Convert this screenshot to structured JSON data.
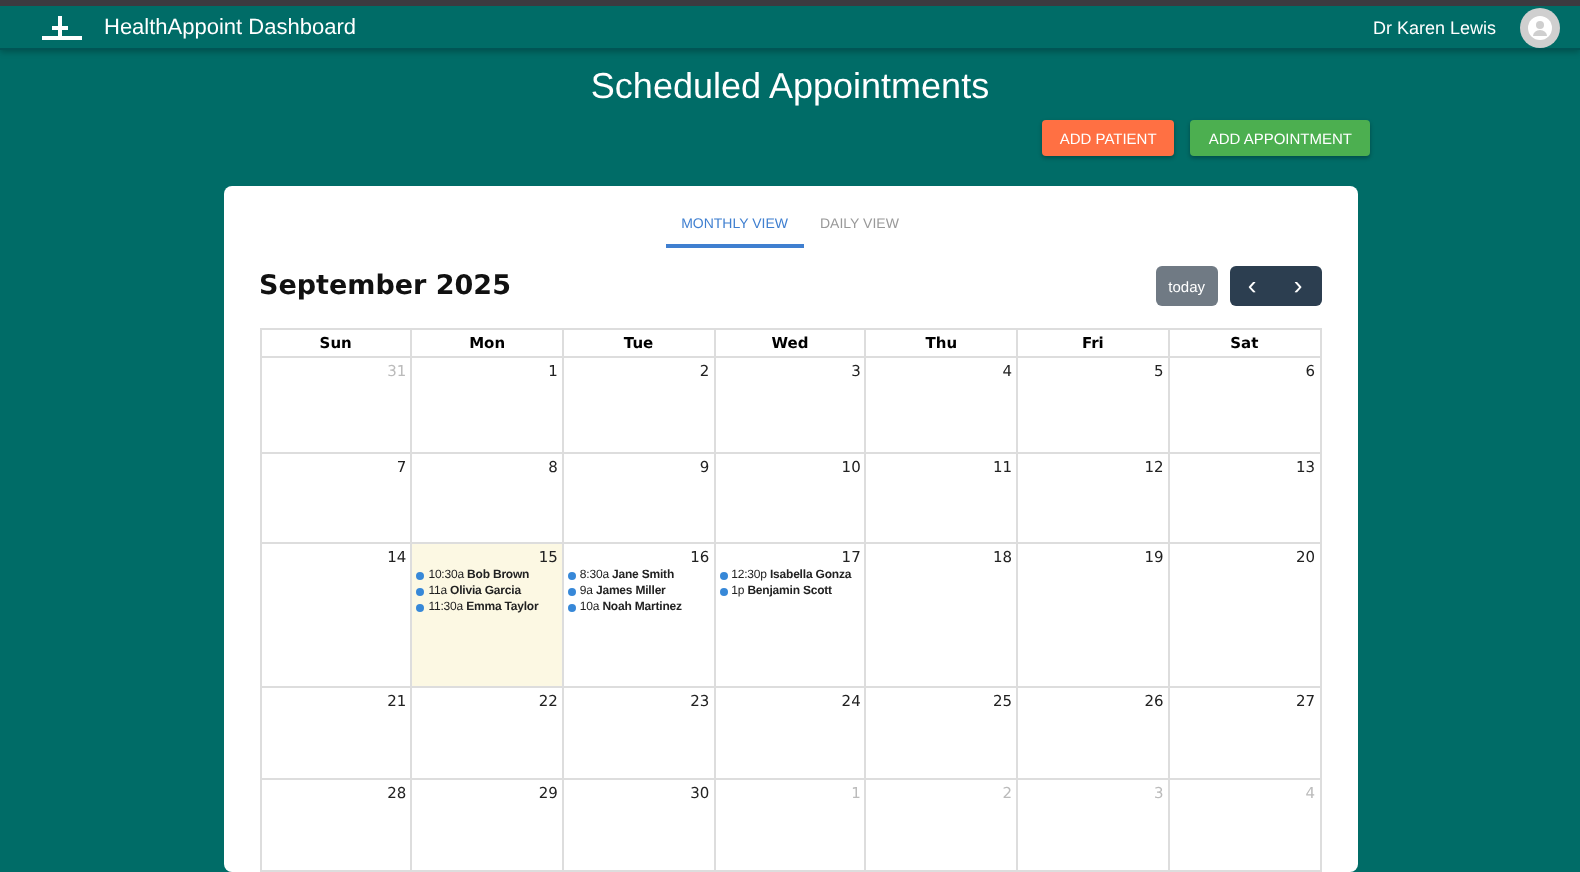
{
  "header": {
    "title": "HealthAppoint Dashboard",
    "user": "Dr Karen Lewis"
  },
  "page_title": "Scheduled Appointments",
  "actions": [
    {
      "label": "ADD PATIENT",
      "kind": "secondary"
    },
    {
      "label": "ADD APPOINTMENT",
      "kind": "primary"
    }
  ],
  "tabs": [
    {
      "label": "MONTHLY VIEW",
      "selected": true
    },
    {
      "label": "DAILY VIEW",
      "selected": false
    }
  ],
  "calendar": {
    "title": "September 2025",
    "today_label": "today",
    "prev": "‹",
    "next": "›",
    "weekdays": [
      "Sun",
      "Mon",
      "Tue",
      "Wed",
      "Thu",
      "Fri",
      "Sat"
    ],
    "weeks": [
      [
        {
          "day": "31",
          "other_month": true,
          "today": false
        },
        {
          "day": "1",
          "other_month": false,
          "today": false
        },
        {
          "day": "2",
          "other_month": false,
          "today": false
        },
        {
          "day": "3",
          "other_month": false,
          "today": false
        },
        {
          "day": "4",
          "other_month": false,
          "today": false
        },
        {
          "day": "5",
          "other_month": false,
          "today": false
        },
        {
          "day": "6",
          "other_month": false,
          "today": false
        }
      ],
      [
        {
          "day": "7",
          "other_month": false,
          "today": false
        },
        {
          "day": "8",
          "other_month": false,
          "today": false
        },
        {
          "day": "9",
          "other_month": false,
          "today": false
        },
        {
          "day": "10",
          "other_month": false,
          "today": false
        },
        {
          "day": "11",
          "other_month": false,
          "today": false
        },
        {
          "day": "12",
          "other_month": false,
          "today": false
        },
        {
          "day": "13",
          "other_month": false,
          "today": false
        }
      ],
      [
        {
          "day": "14",
          "other_month": false,
          "today": false
        },
        {
          "day": "15",
          "other_month": false,
          "today": true,
          "events": [
            {
              "time": "10:30a",
              "name": "Bob Brown"
            },
            {
              "time": "11a",
              "name": "Olivia Garcia"
            },
            {
              "time": "11:30a",
              "name": "Emma Taylor"
            }
          ]
        },
        {
          "day": "16",
          "other_month": false,
          "today": false,
          "events": [
            {
              "time": "8:30a",
              "name": "Jane Smith"
            },
            {
              "time": "9a",
              "name": "James Miller"
            },
            {
              "time": "10a",
              "name": "Noah Martinez"
            }
          ]
        },
        {
          "day": "17",
          "other_month": false,
          "today": false,
          "events": [
            {
              "time": "12:30p",
              "name": "Isabella Gonza"
            },
            {
              "time": "1p",
              "name": "Benjamin Scott"
            }
          ]
        },
        {
          "day": "18",
          "other_month": false,
          "today": false
        },
        {
          "day": "19",
          "other_month": false,
          "today": false
        },
        {
          "day": "20",
          "other_month": false,
          "today": false
        }
      ],
      [
        {
          "day": "21",
          "other_month": false,
          "today": false
        },
        {
          "day": "22",
          "other_month": false,
          "today": false
        },
        {
          "day": "23",
          "other_month": false,
          "today": false
        },
        {
          "day": "24",
          "other_month": false,
          "today": false
        },
        {
          "day": "25",
          "other_month": false,
          "today": false
        },
        {
          "day": "26",
          "other_month": false,
          "today": false
        },
        {
          "day": "27",
          "other_month": false,
          "today": false
        }
      ],
      [
        {
          "day": "28",
          "other_month": false,
          "today": false
        },
        {
          "day": "29",
          "other_month": false,
          "today": false
        },
        {
          "day": "30",
          "other_month": false,
          "today": false
        },
        {
          "day": "1",
          "other_month": true,
          "today": false
        },
        {
          "day": "2",
          "other_month": true,
          "today": false
        },
        {
          "day": "3",
          "other_month": true,
          "today": false
        },
        {
          "day": "4",
          "other_month": true,
          "today": false
        }
      ]
    ]
  }
}
